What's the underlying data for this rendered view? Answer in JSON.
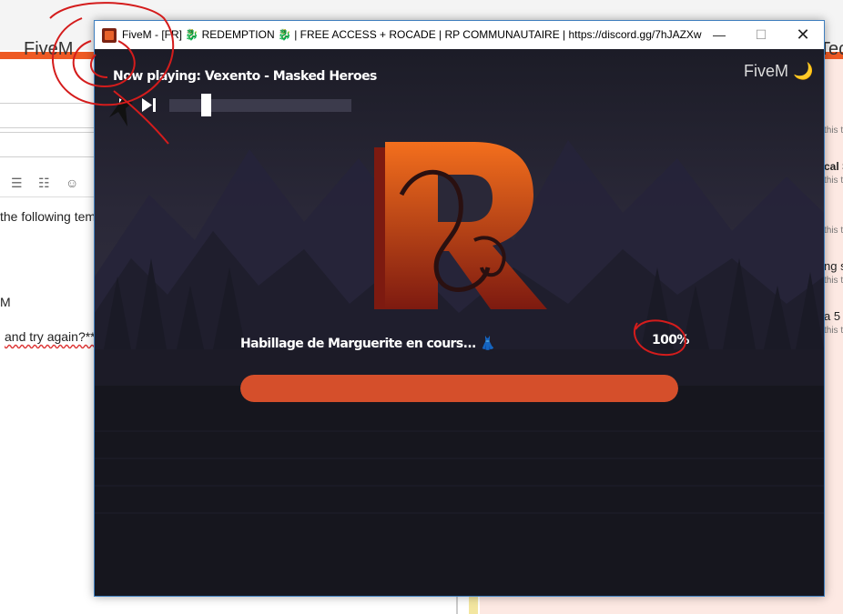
{
  "background": {
    "left_tab_title": "FiveM",
    "right_tab_title": "Tec",
    "toolbar_icons": [
      "list-icon",
      "numbered-list-icon",
      "emoji-icon"
    ],
    "toolbar_glyphs": [
      "☰",
      "☷",
      "☺"
    ],
    "editor_lines": [
      "the following tem",
      "M",
      "and try again?**"
    ],
    "right_panel_items": [
      "this t",
      "cal S",
      "this t",
      "this t",
      "ng s",
      "this t",
      "a 5",
      "this t"
    ]
  },
  "window": {
    "title": "FiveM - [FR] 🐉 REDEMPTION 🐉 | FREE ACCESS + ROCADE | RP COMMUNAUTAIRE | https://discord.gg/7hJAZXw",
    "minimize_glyph": "—",
    "maximize_glyph": "☐",
    "close_glyph": "✕"
  },
  "player": {
    "now_playing": "Now playing: Vexento - Masked Heroes",
    "volume_level": 0.2
  },
  "brand": {
    "name": "FiveM",
    "moon_glyph": "🌙"
  },
  "loading": {
    "status": "Habillage de Marguerite en cours... 👗",
    "percent_label": "100%",
    "progress": 1.0
  },
  "colors": {
    "accent": "#d54f2b",
    "titlebar_bg": "#ffffff",
    "browser_accent": "#ee5a24"
  }
}
